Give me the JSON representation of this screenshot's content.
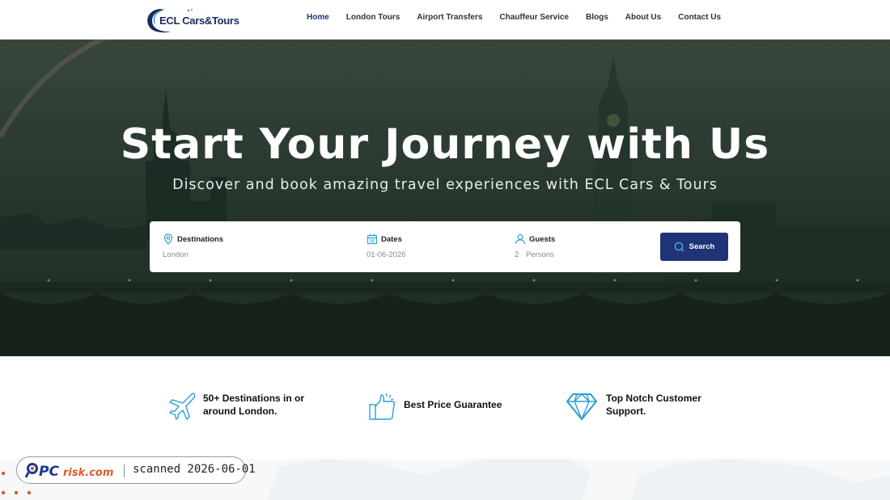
{
  "brand": {
    "logo_text": "ECL Cars&Tours"
  },
  "nav": {
    "items": [
      {
        "label": "Home"
      },
      {
        "label": "London Tours"
      },
      {
        "label": "Airport Transfers"
      },
      {
        "label": "Chauffeur Service"
      },
      {
        "label": "Blogs"
      },
      {
        "label": "About Us"
      },
      {
        "label": "Contact Us"
      }
    ]
  },
  "hero": {
    "title": "Start Your Journey with Us",
    "subtitle": "Discover and book amazing travel experiences with ECL Cars & Tours"
  },
  "search": {
    "destinations_label": "Destinations",
    "destinations_value": "London",
    "dates_label": "Dates",
    "dates_value": "01-06-2026",
    "guests_label": "Guests",
    "guests_count": "2",
    "guests_unit": "Persons",
    "button_label": "Search"
  },
  "features": [
    {
      "icon": "plane-icon",
      "line1": "50+ Destinations in or",
      "line2": "around London."
    },
    {
      "icon": "thumbs-up-icon",
      "line1": "Best Price Guarantee",
      "line2": ""
    },
    {
      "icon": "diamond-icon",
      "line1": "Top Notch Customer",
      "line2": "Support."
    }
  ],
  "watermark": {
    "brand": "PCrisk.com",
    "text": "scanned 2026-06-01"
  },
  "colors": {
    "accent": "#1f3376",
    "icon_blue": "#2a9fd6",
    "hero_overlay": "#233226"
  }
}
